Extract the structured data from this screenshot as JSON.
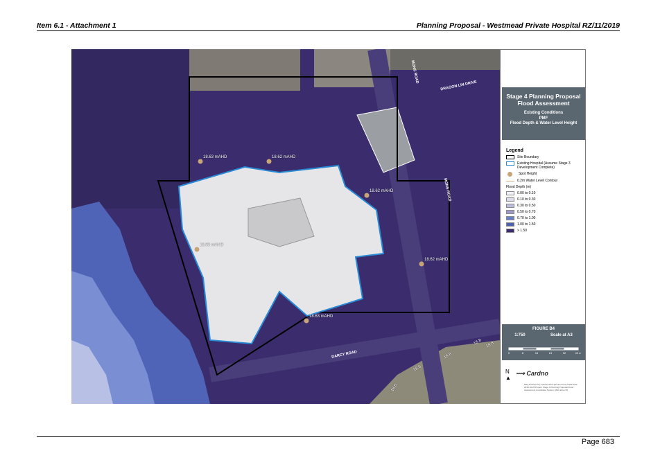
{
  "header": {
    "left": "Item 6.1 - Attachment 1",
    "right": "Planning Proposal - Westmead Private Hospital RZ/11/2019"
  },
  "footer": {
    "page": "Page 683"
  },
  "map": {
    "spot_heights": [
      {
        "label": "18.63 mAHD"
      },
      {
        "label": "18.62 mAHD"
      },
      {
        "label": "18.62 mAHD"
      },
      {
        "label": "18.63 mAHD"
      },
      {
        "label": "18.62 mAHD"
      },
      {
        "label": "18.63 mAHD"
      }
    ],
    "roads": {
      "darcy": "DARCY ROAD",
      "mons": "MONS ROAD",
      "mons2": "MONS ROAD",
      "dragon": "DRAGON LIN DRIVE"
    },
    "contours": [
      "18.8",
      "18.8",
      "18.8",
      "18.6",
      "18.6"
    ]
  },
  "panel": {
    "title": "Stage 4 Planning Proposal Flood Assessment",
    "subtitle_lines": [
      "Existing Conditions",
      "PMF",
      "Flood Depth & Water Level Height"
    ],
    "legend_heading": "Legend",
    "legend_items": {
      "boundary": "Site Boundary",
      "hospital": "Existing Hospital (Assume Stage 3 Development Complete)",
      "spot": "Spot Height",
      "contour": "0.2m Water Level Contour"
    },
    "flood_depth_title": "Flood Depth (m)",
    "flood_classes": [
      {
        "label": "0.00 to 0.10",
        "color": "#f2f0f7"
      },
      {
        "label": "0.10 to 0.30",
        "color": "#dcdbeb"
      },
      {
        "label": "0.30 to 0.50",
        "color": "#bcbddc"
      },
      {
        "label": "0.50 to 0.70",
        "color": "#9e9ac8"
      },
      {
        "label": "0.70 to 1.00",
        "color": "#6a7fc9"
      },
      {
        "label": "1.00 to 1.50",
        "color": "#4a5fae"
      },
      {
        "label": "> 1.50",
        "color": "#3b2b6e"
      }
    ],
    "figure": "FIGURE B4",
    "scale_ratio": "1:750",
    "scale_note": "Scale at A3",
    "scale_ticks": [
      "0",
      "8",
      "16",
      "24",
      "32",
      "40 m"
    ],
    "logo": "Cardno",
    "north": "N",
    "fine_print": "Map Produced by Cardno West (Environment) NSW Date: 2019-10-25 Project: Stage 4 Planning Proposal Flood Assessment Coordinate System: MGA Zone 56"
  }
}
